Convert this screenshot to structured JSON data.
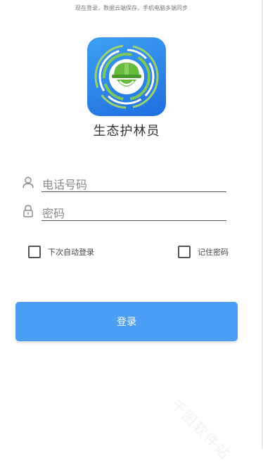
{
  "header": {
    "note": "现在登录，数据云端保存，手机电脑多端同步"
  },
  "app": {
    "name": "生态护林员",
    "icon": "forest-ranger-helmet-icon"
  },
  "form": {
    "phone_placeholder": "电话号码",
    "password_placeholder": "密码",
    "auto_login_label": "下次自动登录",
    "auto_login_checked": false,
    "remember_password_label": "记住密码",
    "remember_password_checked": false,
    "login_button_label": "登录"
  },
  "watermark": {
    "text": "千图软件站"
  },
  "colors": {
    "primary": "#4a9ef4",
    "icon_bg": "#2a7fe8"
  }
}
